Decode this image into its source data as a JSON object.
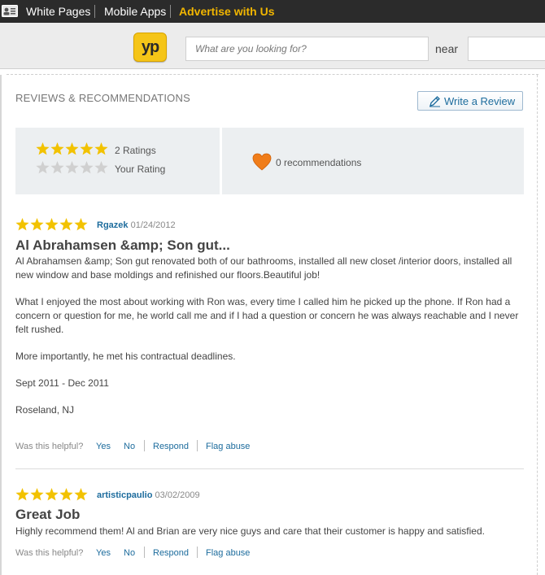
{
  "topbar": {
    "links": [
      "White Pages",
      "Mobile Apps",
      "Advertise with Us"
    ],
    "accent": "#f2b600"
  },
  "header": {
    "logo_text": "yp",
    "search_placeholder": "What are you looking for?",
    "near_label": "near"
  },
  "reviews_section": {
    "title": "REVIEWS & RECOMMENDATIONS",
    "write_review_label": "Write a Review",
    "ratings_count": "2 Ratings",
    "your_rating_label": "Your Rating",
    "recommendations": "0 recommendations",
    "average_rating": 5,
    "your_rating": 0
  },
  "reviews": [
    {
      "stars": 5,
      "author": "Rgazek",
      "date": "01/24/2012",
      "title": "Al Abrahamsen &amp; Son gut...",
      "paragraphs": [
        "Al Abrahamsen &amp; Son gut renovated both of our bathrooms, installed all new closet /interior doors, installed all new window and base moldings and refinished our floors.Beautiful job!",
        "What I enjoyed the most about working with Ron was, every time I called him he picked up the phone. If Ron had a concern or question for me, he world call me and if I had a question or concern he was always reachable and I never felt rushed.",
        "More importantly, he met his contractual deadlines.",
        "Sept 2011 - Dec 2011",
        "Roseland, NJ"
      ]
    },
    {
      "stars": 5,
      "author": "artisticpaulio",
      "date": "03/02/2009",
      "title": "Great Job",
      "paragraphs": [
        "Highly recommend them! Al and Brian are very nice guys and care that their customer is happy and satisfied."
      ]
    }
  ],
  "helpful": {
    "label": "Was this helpful?",
    "yes": "Yes",
    "no": "No",
    "respond": "Respond",
    "flag": "Flag abuse"
  },
  "colors": {
    "star": "#f2c200",
    "star_empty": "#d0d0d0",
    "link": "#1d6c9d",
    "heart": "#f07d1a"
  }
}
